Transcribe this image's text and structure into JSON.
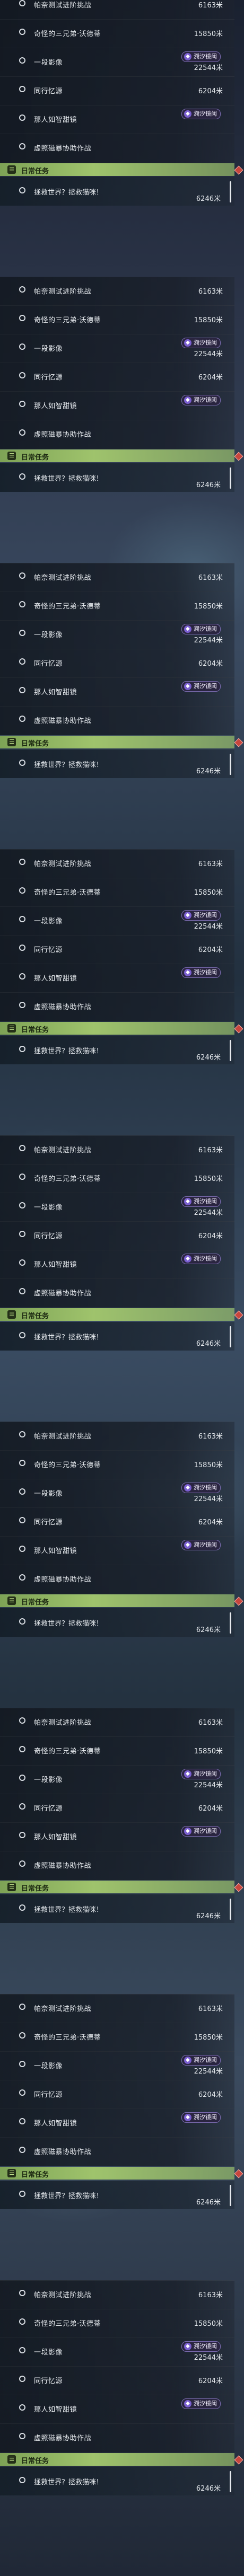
{
  "blocks": [
    {
      "quests": [
        {
          "title": "帕奈测试进阶挑战",
          "distance": "6163米"
        },
        {
          "title": "奇怪的三兄弟·沃德蒂",
          "distance": "15850米"
        },
        {
          "title": "一段影像",
          "distance": "22544米",
          "badge": "溯汐镜阈"
        },
        {
          "title": "同行忆源",
          "distance": "6204米"
        },
        {
          "title": "那人如智甜镜",
          "badge": "溯汐镜阈"
        },
        {
          "title": "虚照磁暴协助作战"
        }
      ],
      "category": "日常任务",
      "daily": {
        "title": "拯救世界？拯救猫咪！",
        "distance": "6246米"
      }
    },
    {
      "quests": [
        {
          "title": "帕奈测试进阶挑战",
          "distance": "6163米"
        },
        {
          "title": "奇怪的三兄弟·沃德蒂",
          "distance": "15850米"
        },
        {
          "title": "一段影像",
          "distance": "22544米",
          "badge": "溯汐镜阈"
        },
        {
          "title": "同行忆源",
          "distance": "6204米"
        },
        {
          "title": "那人如智甜镜",
          "badge": "溯汐镜阈"
        },
        {
          "title": "虚照磁暴协助作战"
        }
      ],
      "category": "日常任务",
      "daily": {
        "title": "拯救世界？拯救猫咪！",
        "distance": "6246米"
      }
    },
    {
      "quests": [
        {
          "title": "帕奈测试进阶挑战",
          "distance": "6163米"
        },
        {
          "title": "奇怪的三兄弟·沃德蒂",
          "distance": "15850米"
        },
        {
          "title": "一段影像",
          "distance": "22544米",
          "badge": "溯汐镜阈"
        },
        {
          "title": "同行忆源",
          "distance": "6204米"
        },
        {
          "title": "那人如智甜镜",
          "badge": "溯汐镜阈"
        },
        {
          "title": "虚照磁暴协助作战"
        }
      ],
      "category": "日常任务",
      "daily": {
        "title": "拯救世界？拯救猫咪！",
        "distance": "6246米"
      }
    },
    {
      "quests": [
        {
          "title": "帕奈测试进阶挑战",
          "distance": "6163米"
        },
        {
          "title": "奇怪的三兄弟·沃德蒂",
          "distance": "15850米"
        },
        {
          "title": "一段影像",
          "distance": "22544米",
          "badge": "溯汐镜阈"
        },
        {
          "title": "同行忆源",
          "distance": "6204米"
        },
        {
          "title": "那人如智甜镜",
          "badge": "溯汐镜阈"
        },
        {
          "title": "虚照磁暴协助作战"
        }
      ],
      "category": "日常任务",
      "daily": {
        "title": "拯救世界？拯救猫咪！",
        "distance": "6246米"
      }
    },
    {
      "quests": [
        {
          "title": "帕奈测试进阶挑战",
          "distance": "6163米"
        },
        {
          "title": "奇怪的三兄弟·沃德蒂",
          "distance": "15850米"
        },
        {
          "title": "一段影像",
          "distance": "22544米",
          "badge": "溯汐镜阈"
        },
        {
          "title": "同行忆源",
          "distance": "6204米"
        },
        {
          "title": "那人如智甜镜",
          "badge": "溯汐镜阈"
        },
        {
          "title": "虚照磁暴协助作战"
        }
      ],
      "category": "日常任务",
      "daily": {
        "title": "拯救世界？拯救猫咪！",
        "distance": "6246米"
      }
    },
    {
      "quests": [
        {
          "title": "帕奈测试进阶挑战",
          "distance": "6163米"
        },
        {
          "title": "奇怪的三兄弟·沃德蒂",
          "distance": "15850米"
        },
        {
          "title": "一段影像",
          "distance": "22544米",
          "badge": "溯汐镜阈"
        },
        {
          "title": "同行忆源",
          "distance": "6204米"
        },
        {
          "title": "那人如智甜镜",
          "badge": "溯汐镜阈"
        },
        {
          "title": "虚照磁暴协助作战"
        }
      ],
      "category": "日常任务",
      "daily": {
        "title": "拯救世界？拯救猫咪！",
        "distance": "6246米"
      }
    },
    {
      "quests": [
        {
          "title": "帕奈测试进阶挑战",
          "distance": "6163米"
        },
        {
          "title": "奇怪的三兄弟·沃德蒂",
          "distance": "15850米"
        },
        {
          "title": "一段影像",
          "distance": "22544米",
          "badge": "溯汐镜阈"
        },
        {
          "title": "同行忆源",
          "distance": "6204米"
        },
        {
          "title": "那人如智甜镜",
          "badge": "溯汐镜阈"
        },
        {
          "title": "虚照磁暴协助作战"
        }
      ],
      "category": "日常任务",
      "daily": {
        "title": "拯救世界？拯救猫咪！",
        "distance": "6246米"
      }
    },
    {
      "quests": [
        {
          "title": "帕奈测试进阶挑战",
          "distance": "6163米"
        },
        {
          "title": "奇怪的三兄弟·沃德蒂",
          "distance": "15850米"
        },
        {
          "title": "一段影像",
          "distance": "22544米",
          "badge": "溯汐镜阈"
        },
        {
          "title": "同行忆源",
          "distance": "6204米"
        },
        {
          "title": "那人如智甜镜",
          "badge": "溯汐镜阈"
        },
        {
          "title": "虚照磁暴协助作战"
        }
      ],
      "category": "日常任务",
      "daily": {
        "title": "拯救世界？拯救猫咪！",
        "distance": "6246米"
      }
    },
    {
      "quests": [
        {
          "title": "帕奈测试进阶挑战",
          "distance": "6163米"
        },
        {
          "title": "奇怪的三兄弟·沃德蒂",
          "distance": "15850米"
        },
        {
          "title": "一段影像",
          "distance": "22544米",
          "badge": "溯汐镜阈"
        },
        {
          "title": "同行忆源",
          "distance": "6204米"
        },
        {
          "title": "那人如智甜镜",
          "badge": "溯汐镜阈"
        },
        {
          "title": "虚照磁暴协助作战"
        }
      ],
      "category": "日常任务",
      "daily": {
        "title": "拯救世界？拯救猫咪！",
        "distance": "6246米"
      }
    }
  ]
}
